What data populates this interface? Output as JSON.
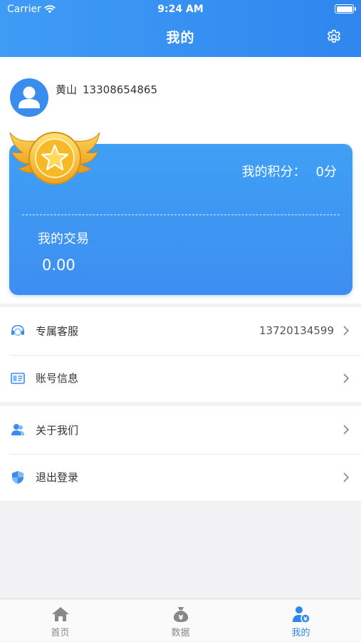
{
  "status_bar": {
    "carrier": "Carrier",
    "time": "9:24 AM"
  },
  "header": {
    "title": "我的",
    "settings_icon": "gear-icon"
  },
  "profile": {
    "name": "黄山",
    "phone": "13308654865",
    "avatar_icon": "user-avatar-icon"
  },
  "card": {
    "points_label": "我的积分：",
    "points_value": "0分",
    "trade_label": "我的交易",
    "trade_value": "0.00",
    "medal_icon": "gold-star-medal-icon",
    "accent": "#3d8ef0"
  },
  "menu": {
    "group1": [
      {
        "label": "专属客服",
        "value": "13720134599",
        "icon": "headset-icon"
      },
      {
        "label": "账号信息",
        "value": "",
        "icon": "id-card-icon"
      }
    ],
    "group2": [
      {
        "label": "关于我们",
        "value": "",
        "icon": "people-icon"
      },
      {
        "label": "退出登录",
        "value": "",
        "icon": "shield-icon"
      }
    ]
  },
  "tabs": [
    {
      "label": "首页",
      "icon": "home-icon",
      "active": false
    },
    {
      "label": "数据",
      "icon": "money-bag-icon",
      "active": false
    },
    {
      "label": "我的",
      "icon": "user-yen-icon",
      "active": true
    }
  ],
  "colors": {
    "primary": "#2f86ee",
    "tab_inactive": "#888888",
    "background": "#f2f2f4"
  }
}
